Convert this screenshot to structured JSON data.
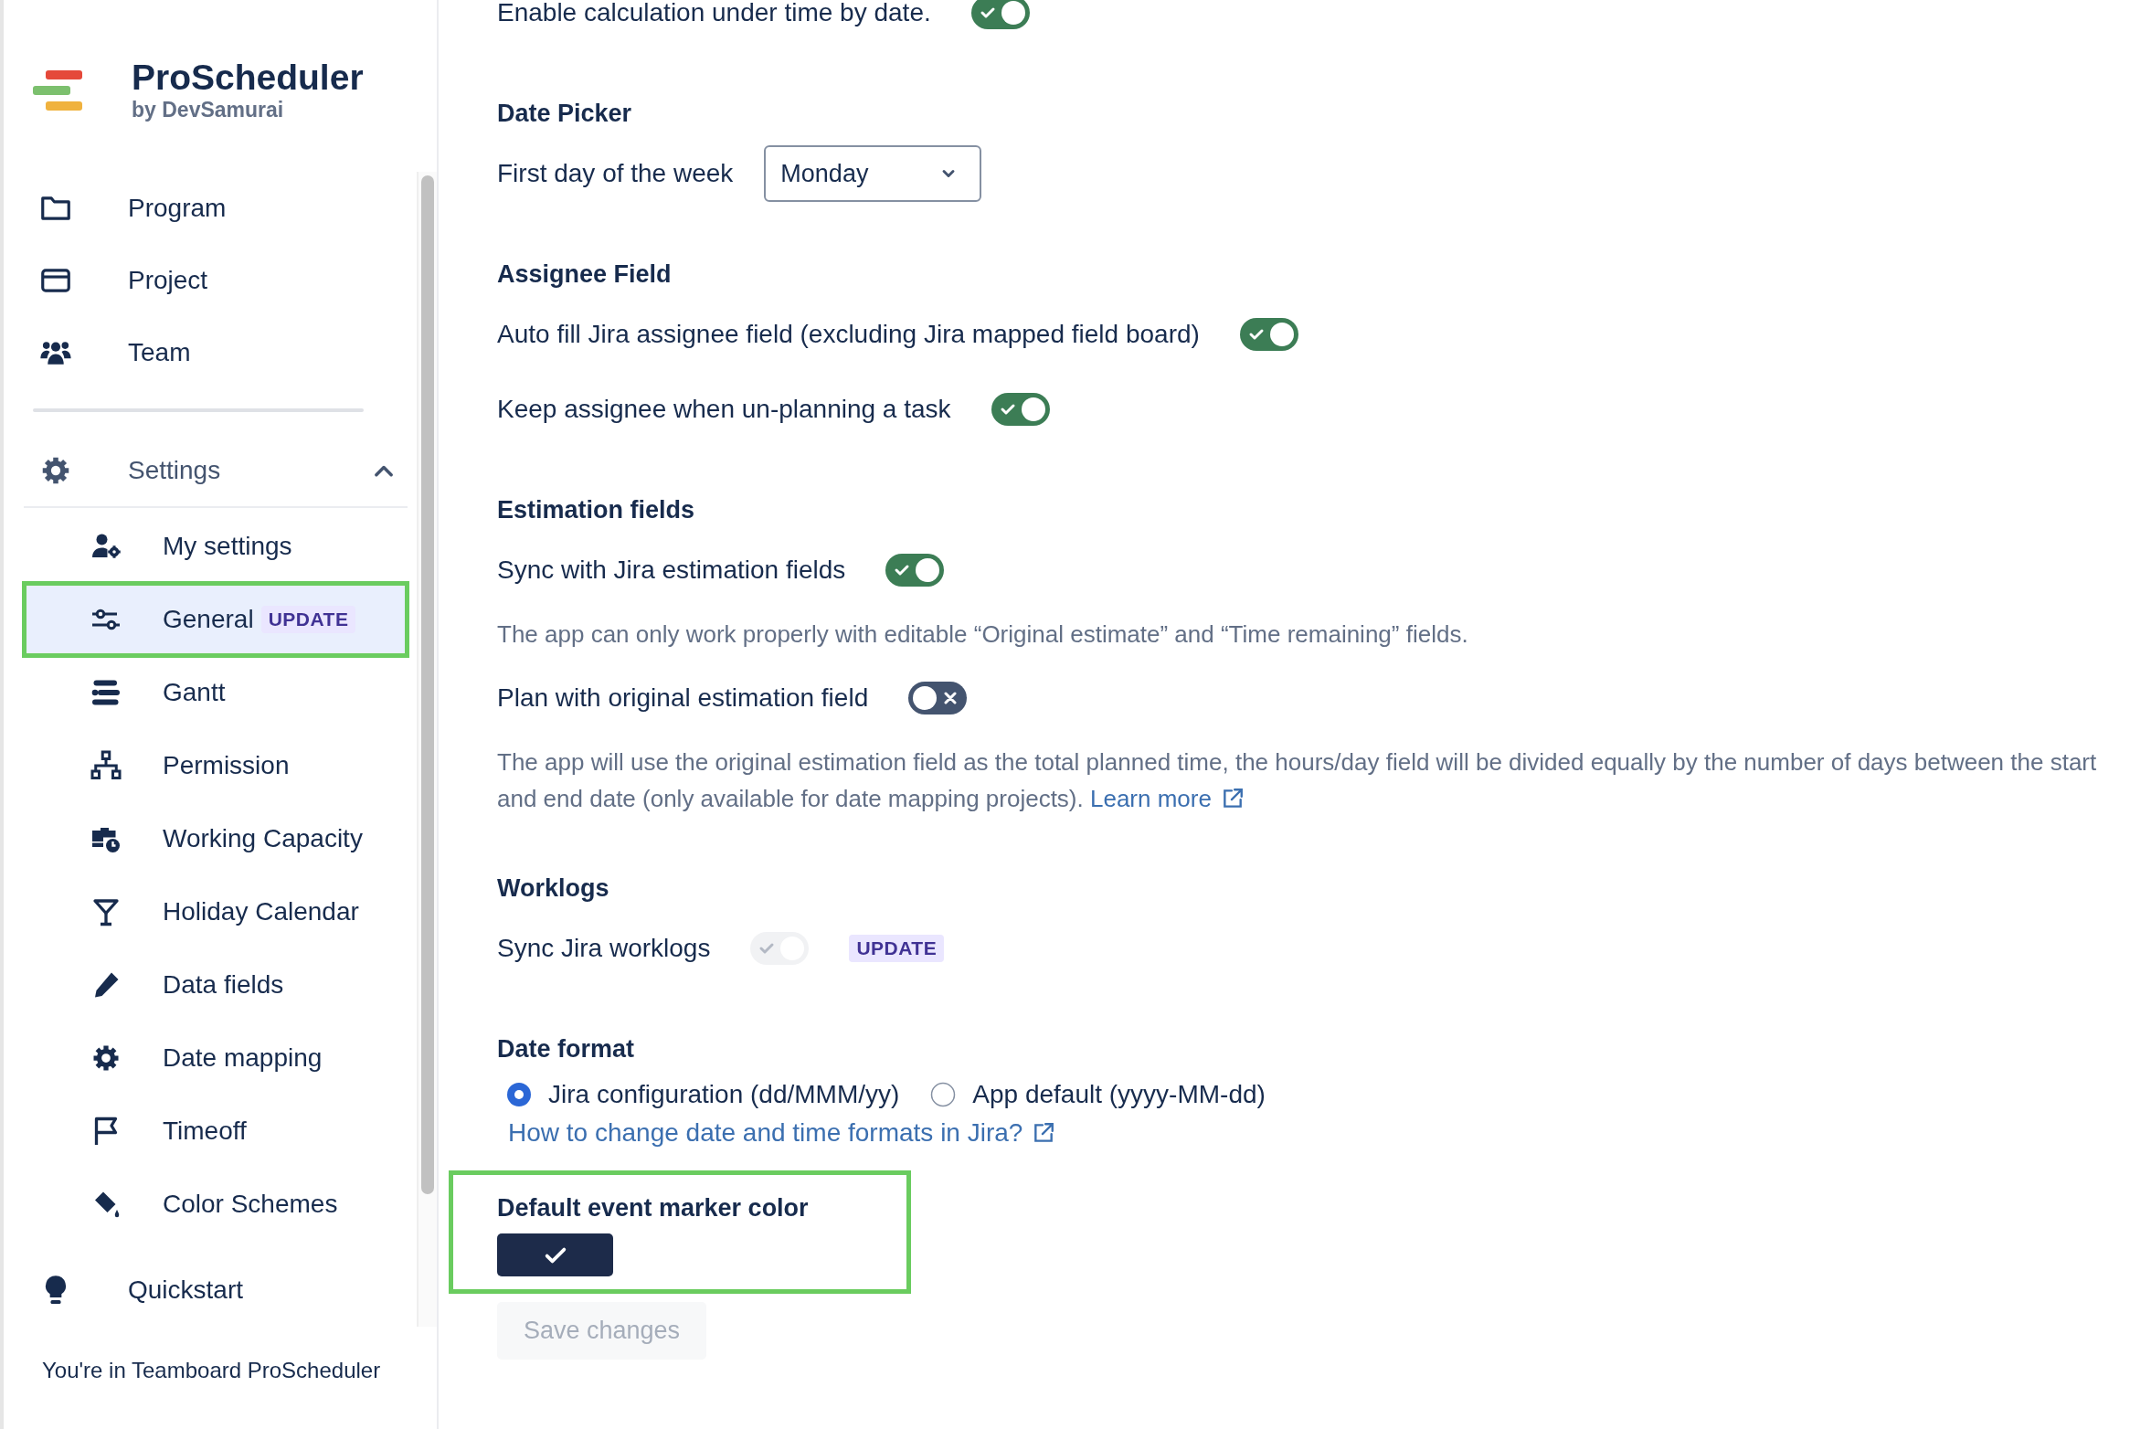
{
  "sidebar": {
    "brand": {
      "title": "ProScheduler",
      "subtitle": "by DevSamurai"
    },
    "nav": [
      {
        "label": "Program",
        "selected": false
      },
      {
        "label": "Project",
        "selected": false
      },
      {
        "label": "Team",
        "selected": false
      }
    ],
    "settings": {
      "label": "Settings",
      "expanded": true,
      "items": [
        {
          "label": "My settings",
          "selected": false,
          "highlighted": false
        },
        {
          "label": "General",
          "selected": true,
          "highlighted": true,
          "badge": "UPDATE"
        },
        {
          "label": "Gantt",
          "selected": false,
          "highlighted": false
        },
        {
          "label": "Permission",
          "selected": false,
          "highlighted": false
        },
        {
          "label": "Working Capacity",
          "selected": false,
          "highlighted": false
        },
        {
          "label": "Holiday Calendar",
          "selected": false,
          "highlighted": false
        },
        {
          "label": "Data fields",
          "selected": false,
          "highlighted": false
        },
        {
          "label": "Date mapping",
          "selected": false,
          "highlighted": false
        },
        {
          "label": "Timeoff",
          "selected": false,
          "highlighted": false
        },
        {
          "label": "Color Schemes",
          "selected": false,
          "highlighted": false
        }
      ]
    },
    "quickstart": {
      "label": "Quickstart",
      "selected": false
    },
    "footer": "You're in Teamboard ProScheduler"
  },
  "sections": [
    {
      "highlighted": false,
      "items": [
        {
          "kind": "toggle",
          "label": "Enable calculation under time by date.",
          "on": true,
          "disabled": false
        }
      ]
    },
    {
      "heading": "Date Picker",
      "highlighted": false,
      "items": [
        {
          "kind": "select",
          "label": "First day of the week",
          "value": "Monday"
        }
      ]
    },
    {
      "heading": "Assignee Field",
      "highlighted": false,
      "items": [
        {
          "kind": "toggle",
          "label": "Auto fill Jira assignee field (excluding Jira mapped field board)",
          "on": true,
          "disabled": false
        },
        {
          "kind": "toggle",
          "label": "Keep assignee when un-planning a task",
          "on": true,
          "disabled": false
        }
      ]
    },
    {
      "heading": "Estimation fields",
      "highlighted": false,
      "items": [
        {
          "kind": "toggle",
          "label": "Sync with Jira estimation fields",
          "on": true,
          "disabled": false
        },
        {
          "kind": "note",
          "text": "The app can only work properly with editable “Original estimate” and “Time remaining” fields."
        },
        {
          "kind": "toggle",
          "label": "Plan with original estimation field",
          "on": false,
          "disabled": false
        },
        {
          "kind": "note",
          "text": "The app will use the original estimation field as the total planned time, the hours/day field will be divided equally by the number of days between the start and end date (only available for date mapping projects).",
          "link": "Learn more"
        }
      ]
    },
    {
      "heading": "Worklogs",
      "highlighted": false,
      "items": [
        {
          "kind": "toggle",
          "label": "Sync Jira worklogs",
          "on": true,
          "disabled": true,
          "badge": "UPDATE"
        }
      ]
    },
    {
      "heading": "Date format",
      "highlighted": false,
      "items": [
        {
          "kind": "radios",
          "options": [
            {
              "label": "Jira configuration (dd/MMM/yy)",
              "selected": true
            },
            {
              "label": "App default (yyyy-MM-dd)",
              "selected": false
            }
          ]
        },
        {
          "kind": "link",
          "text": "How to change date and time formats in Jira?"
        }
      ]
    },
    {
      "heading": "Default event marker color",
      "highlighted": true,
      "items": [
        {
          "kind": "color",
          "color": "#1d2b4a",
          "selected": true
        }
      ]
    }
  ],
  "save_button": {
    "label": "Save changes",
    "disabled": true
  }
}
